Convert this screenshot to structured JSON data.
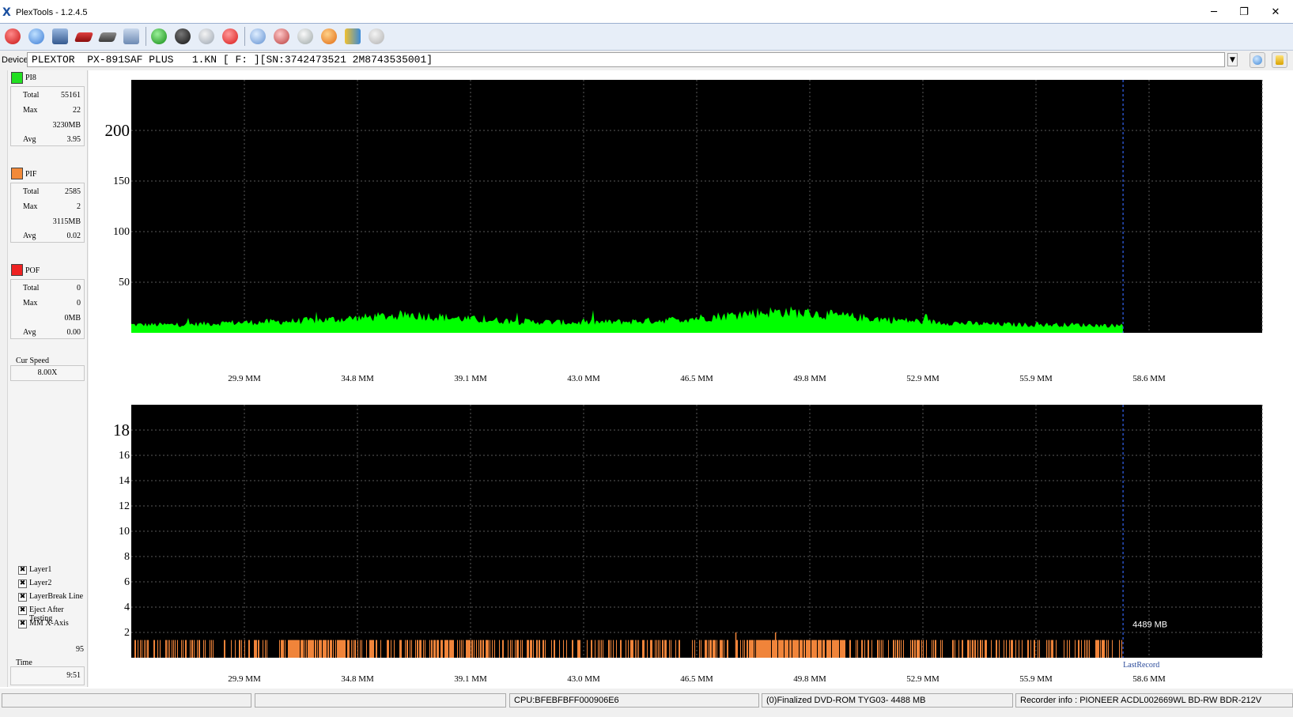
{
  "window": {
    "title": "PlexTools - 1.2.4.5",
    "app_icon": "X",
    "controls": {
      "minimize": "─",
      "maximize": "❐",
      "close": "✕"
    }
  },
  "toolbar": {
    "icons": [
      "power-icon",
      "drive-info-icon",
      "scan-icon",
      "disc-red-icon",
      "disc-gray-icon",
      "print-icon",
      "refresh-icon",
      "cd-drive-icon",
      "eject-icon",
      "stop-icon",
      "disc-blue-icon",
      "burn-disc-icon",
      "record-icon",
      "flame-icon",
      "book-icon",
      "settings-icon"
    ]
  },
  "device": {
    "label": "Device:",
    "value": "PLEXTOR  PX-891SAF PLUS   1.KN [ F: ][SN:3742473521 2M8743535001]"
  },
  "pi8": {
    "label": "PI8",
    "color": "#22e022",
    "total_label": "Total",
    "total": "55161",
    "max_label": "Max",
    "max": "22",
    "pos": "3230MB",
    "avg_label": "Avg",
    "avg": "3.95"
  },
  "pif": {
    "label": "PIF",
    "color": "#f28a3a",
    "total_label": "Total",
    "total": "2585",
    "max_label": "Max",
    "max": "2",
    "pos": "3115MB",
    "avg_label": "Avg",
    "avg": "0.02"
  },
  "pof": {
    "label": "POF",
    "color": "#ee2222",
    "total_label": "Total",
    "total": "0",
    "max_label": "Max",
    "max": "0",
    "pos": "0MB",
    "avg_label": "Avg",
    "avg": "0.00"
  },
  "speed": {
    "label": "Cur Speed",
    "value": "8.00X"
  },
  "options": [
    {
      "label": "Layer1",
      "checked": true
    },
    {
      "label": "Layer2",
      "checked": true
    },
    {
      "label": "LayerBreak Line",
      "checked": true
    },
    {
      "label": "Eject After Testing",
      "checked": true
    },
    {
      "label": "MM X-Axis",
      "checked": true
    }
  ],
  "progress_value": "95",
  "time": {
    "label": "Time",
    "value": "9:51"
  },
  "check_mark": "✖",
  "chart_data": [
    {
      "type": "bar",
      "series": [
        {
          "name": "PI8",
          "color": "#00ff00"
        }
      ],
      "x_ticks": [
        "29.9 MM",
        "34.8 MM",
        "39.1 MM",
        "43.0 MM",
        "46.5 MM",
        "49.8 MM",
        "52.9 MM",
        "55.9 MM",
        "58.6 MM"
      ],
      "y_ticks": [
        "200",
        "150",
        "100",
        "50"
      ],
      "y_tick_values": [
        200,
        150,
        100,
        50
      ],
      "ylim": [
        0,
        250
      ],
      "grid": true,
      "profile": [
        [
          0,
          8
        ],
        [
          0.05,
          8
        ],
        [
          0.1,
          10
        ],
        [
          0.15,
          11
        ],
        [
          0.2,
          13
        ],
        [
          0.25,
          16
        ],
        [
          0.28,
          18
        ],
        [
          0.32,
          15
        ],
        [
          0.35,
          13
        ],
        [
          0.4,
          11
        ],
        [
          0.45,
          10
        ],
        [
          0.5,
          11
        ],
        [
          0.55,
          13
        ],
        [
          0.6,
          17
        ],
        [
          0.63,
          20
        ],
        [
          0.66,
          21
        ],
        [
          0.7,
          18
        ],
        [
          0.75,
          14
        ],
        [
          0.8,
          11
        ],
        [
          0.85,
          9
        ],
        [
          0.9,
          8
        ],
        [
          0.95,
          8
        ],
        [
          1.0,
          7
        ]
      ],
      "data_end_fraction": 0.877
    },
    {
      "type": "bar",
      "series": [
        {
          "name": "PIF",
          "color": "#f0843a"
        }
      ],
      "x_ticks": [
        "29.9 MM",
        "34.8 MM",
        "39.1 MM",
        "43.0 MM",
        "46.5 MM",
        "49.8 MM",
        "52.9 MM",
        "55.9 MM",
        "58.6 MM"
      ],
      "y_ticks": [
        "18",
        "16",
        "14",
        "12",
        "10",
        "8",
        "6",
        "4",
        "2"
      ],
      "y_tick_values": [
        18,
        16,
        14,
        12,
        10,
        8,
        6,
        4,
        2
      ],
      "ylim": [
        0,
        20
      ],
      "grid": true,
      "max_value": 2,
      "data_end_fraction": 0.877,
      "annotation": "4489 MB",
      "last_record_label": "LastRecord"
    }
  ],
  "status": {
    "cpu": "CPU:BFEBFBFF000906E6",
    "disc": "(0)Finalized  DVD-ROM  TYG03-  4488 MB",
    "recorder": "Recorder info  : PIONEER          ACDL002669WL   BD-RW   BDR-212V"
  }
}
